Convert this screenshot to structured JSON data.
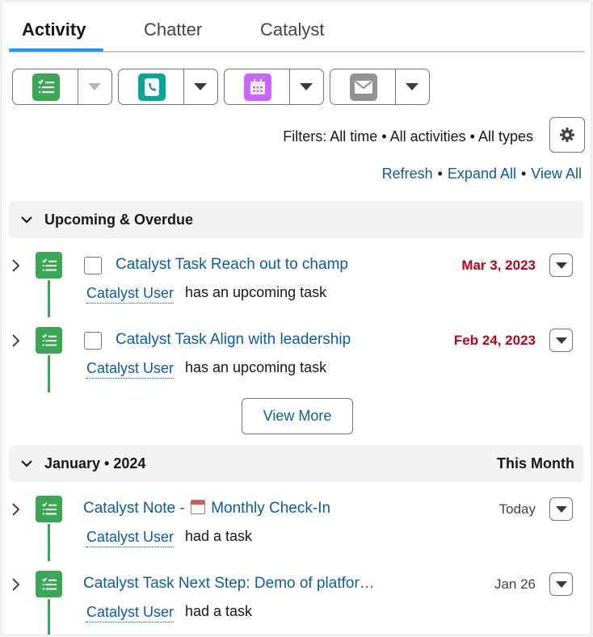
{
  "tabs": [
    {
      "label": "Activity",
      "active": true
    },
    {
      "label": "Chatter",
      "active": false
    },
    {
      "label": "Catalyst",
      "active": false
    }
  ],
  "actions": [
    {
      "name": "new-task",
      "icon": "task-icon",
      "color": "#3ba755"
    },
    {
      "name": "log-call",
      "icon": "call-log-icon",
      "color": "#06a59a"
    },
    {
      "name": "new-event",
      "icon": "calendar-icon",
      "color": "#cb65ff"
    },
    {
      "name": "email",
      "icon": "email-icon",
      "color": "#939393"
    }
  ],
  "filters": {
    "text": "Filters: All time • All activities • All types"
  },
  "links": {
    "refresh": "Refresh",
    "expand_all": "Expand All",
    "view_all": "View All",
    "separator": "•"
  },
  "sections": {
    "upcoming": {
      "title": "Upcoming & Overdue"
    },
    "january": {
      "title": "January • 2024",
      "right": "This Month"
    }
  },
  "upcoming_items": [
    {
      "subject": "Catalyst Task Reach out to champ",
      "date": "Mar 3, 2023",
      "user": "Catalyst User",
      "desc": "has an upcoming task"
    },
    {
      "subject": "Catalyst Task Align with leadership",
      "date": "Feb 24, 2023",
      "user": "Catalyst User",
      "desc": "has an upcoming task"
    }
  ],
  "view_more": "View More",
  "month_items": [
    {
      "subject_prefix": "Catalyst Note - ",
      "subject_suffix": " Monthly Check-In",
      "date": "Today",
      "user": "Catalyst User",
      "desc": "had a task"
    },
    {
      "subject": "Catalyst Task Next Step: Demo of platfor…",
      "date": "Jan 26",
      "user": "Catalyst User",
      "desc": "had a task"
    }
  ],
  "colors": {
    "accent": "#1b96ff",
    "link": "#0b5cab",
    "overdue": "#ba0517",
    "task_green": "#3ba755"
  }
}
